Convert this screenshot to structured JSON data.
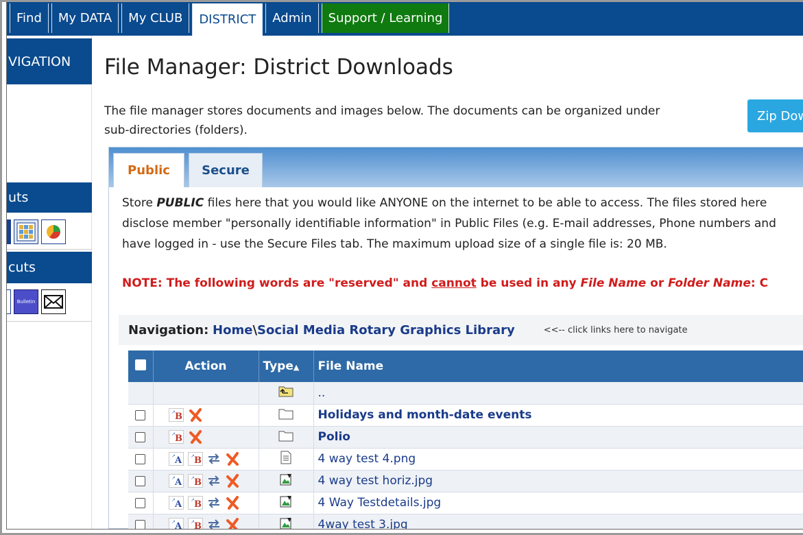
{
  "topnav": {
    "tabs": [
      {
        "label": "Find"
      },
      {
        "label": "My DATA"
      },
      {
        "label": "My CLUB"
      },
      {
        "label": "DISTRICT",
        "active": true
      },
      {
        "label": "Admin"
      },
      {
        "label": "Support / Learning",
        "style": "green"
      }
    ]
  },
  "sidebar": {
    "nav_header": "VIGATION",
    "shortcuts1_header": "uts",
    "shortcuts2_header": "cuts",
    "icons1": [
      "report-icon",
      "calendar-grid-icon",
      "chart-icon"
    ],
    "icons2": [
      "bulletin-icon",
      "email-icon"
    ],
    "bulletin_label": "Bulletin"
  },
  "main": {
    "title": "File Manager: District Downloads",
    "intro_line1": "The file manager stores documents and images below. The documents can be organized under",
    "intro_line2": "sub-directories (folders).",
    "zip_button": "Zip Dow",
    "tabs": [
      {
        "label": "Public",
        "active": true
      },
      {
        "label": "Secure"
      }
    ],
    "desc_store": "Store ",
    "desc_public": "PUBLIC",
    "desc_line1_rest": " files here that you would like ANYONE on the internet to be able to access. The files stored here",
    "desc_line2": "disclose member \"personally identifiable information\" in Public Files (e.g. E-mail addresses, Phone numbers and",
    "desc_line3": "have logged in - use the Secure Files tab. The maximum upload size of a single file is: 20 MB.",
    "note_a": "NOTE: The following words are \"reserved\" and ",
    "note_cannot": "cannot",
    "note_b": " be used in any ",
    "note_filename": "File Name",
    "note_or": " or ",
    "note_foldername": "Folder Name",
    "note_c": ": C",
    "navigation": {
      "label": "Navigation:",
      "home": "Home",
      "separator": " \\ ",
      "current": "Social Media Rotary Graphics Library",
      "hint": "<<-- click links here to navigate"
    },
    "table": {
      "headers": {
        "action": "Action",
        "type": "Type",
        "file_name": "File Name"
      },
      "rows": [
        {
          "kind": "up",
          "name": ".."
        },
        {
          "kind": "folder",
          "name": "Holidays and month-date events"
        },
        {
          "kind": "folder",
          "name": "Polio"
        },
        {
          "kind": "doc",
          "name": "4 way test 4.png"
        },
        {
          "kind": "img",
          "name": "4 way test horiz.jpg"
        },
        {
          "kind": "img",
          "name": "4 Way Testdetails.jpg"
        },
        {
          "kind": "img",
          "name": "4way test 3.jpg"
        }
      ]
    }
  },
  "colors": {
    "nav_blue": "#0a4a8e",
    "support_green": "#0f7a0f",
    "zip_button": "#2aa7e0",
    "note_red": "#d01c1c",
    "header_blue": "#2e6aa7",
    "active_tab_orange": "#d46a14"
  }
}
